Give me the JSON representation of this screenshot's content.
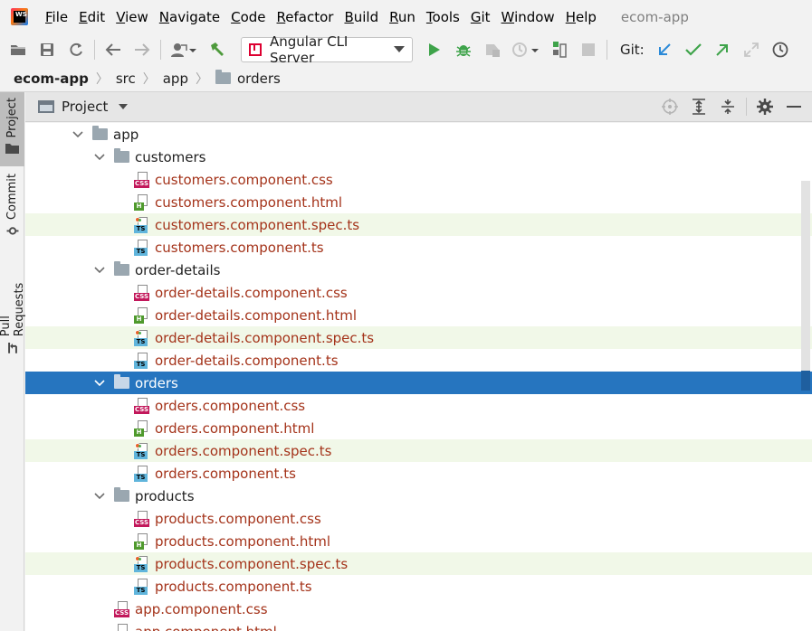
{
  "menubar": {
    "items": [
      "File",
      "Edit",
      "View",
      "Navigate",
      "Code",
      "Refactor",
      "Build",
      "Run",
      "Tools",
      "Git",
      "Window",
      "Help"
    ],
    "window_title": "ecom-app"
  },
  "toolbar": {
    "run_config": "Angular CLI Server",
    "git_label": "Git:"
  },
  "breadcrumb": [
    "ecom-app",
    "src",
    "app",
    "orders"
  ],
  "tool_strip": {
    "tabs": [
      "Project",
      "Commit",
      "Pull Requests"
    ]
  },
  "panel": {
    "title": "Project"
  },
  "tree": {
    "root": "app",
    "folders": [
      {
        "name": "customers",
        "files": [
          "customers.component.css",
          "customers.component.html",
          "customers.component.spec.ts",
          "customers.component.ts"
        ]
      },
      {
        "name": "order-details",
        "files": [
          "order-details.component.css",
          "order-details.component.html",
          "order-details.component.spec.ts",
          "order-details.component.ts"
        ]
      },
      {
        "name": "orders",
        "selected": true,
        "files": [
          "orders.component.css",
          "orders.component.html",
          "orders.component.spec.ts",
          "orders.component.ts"
        ]
      },
      {
        "name": "products",
        "files": [
          "products.component.css",
          "products.component.html",
          "products.component.spec.ts",
          "products.component.ts"
        ]
      }
    ],
    "trailing_files": [
      "app.component.css",
      "app.component.html"
    ]
  },
  "colors": {
    "selection": "#2675bf",
    "spec_row": "#f1f8e8",
    "file_text": "#a4331a",
    "run_green": "#3ea34a"
  }
}
